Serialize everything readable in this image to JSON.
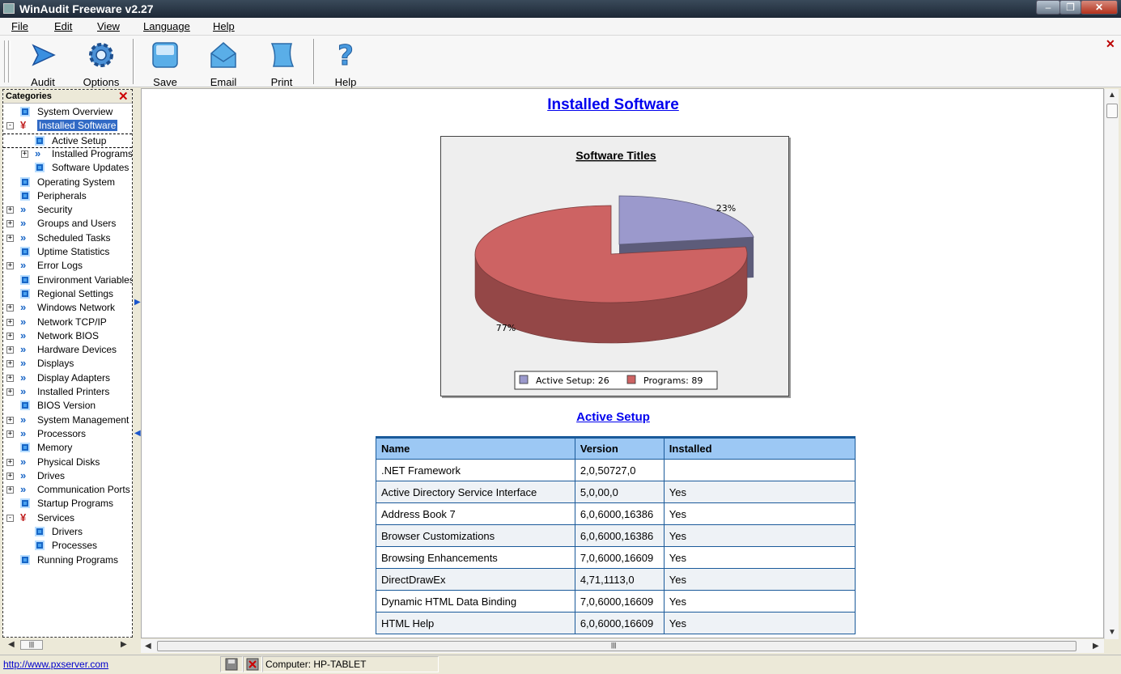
{
  "window": {
    "title": "WinAudit Freeware v2.27"
  },
  "menu": [
    "File",
    "Edit",
    "View",
    "Language",
    "Help"
  ],
  "toolbar": {
    "audit_label": "Audit",
    "options_label": "Options",
    "save_label": "Save",
    "email_label": "Email",
    "print_label": "Print",
    "help_label": "Help"
  },
  "sidebar": {
    "header": "Categories",
    "items": [
      {
        "label": "System Overview"
      },
      {
        "label": "Installed Software"
      },
      {
        "label": "Active Setup"
      },
      {
        "label": "Installed Programs"
      },
      {
        "label": "Software Updates"
      },
      {
        "label": "Operating System"
      },
      {
        "label": "Peripherals"
      },
      {
        "label": "Security"
      },
      {
        "label": "Groups and Users"
      },
      {
        "label": "Scheduled Tasks"
      },
      {
        "label": "Uptime Statistics"
      },
      {
        "label": "Error Logs"
      },
      {
        "label": "Environment Variables"
      },
      {
        "label": "Regional Settings"
      },
      {
        "label": "Windows Network"
      },
      {
        "label": "Network TCP/IP"
      },
      {
        "label": "Network BIOS"
      },
      {
        "label": "Hardware Devices"
      },
      {
        "label": "Displays"
      },
      {
        "label": "Display Adapters"
      },
      {
        "label": "Installed Printers"
      },
      {
        "label": "BIOS Version"
      },
      {
        "label": "System Management"
      },
      {
        "label": "Processors"
      },
      {
        "label": "Memory"
      },
      {
        "label": "Physical Disks"
      },
      {
        "label": "Drives"
      },
      {
        "label": "Communication Ports"
      },
      {
        "label": "Startup Programs"
      },
      {
        "label": "Services"
      },
      {
        "label": "Drivers"
      },
      {
        "label": "Processes"
      },
      {
        "label": "Running Programs"
      }
    ]
  },
  "main": {
    "title": "Installed Software",
    "section_title": "Active Setup",
    "table": {
      "headers": [
        "Name",
        "Version",
        "Installed"
      ],
      "rows": [
        [
          ".NET Framework",
          "2,0,50727,0",
          ""
        ],
        [
          "Active Directory Service Interface",
          "5,0,00,0",
          "Yes"
        ],
        [
          "Address Book 7",
          "6,0,6000,16386",
          "Yes"
        ],
        [
          "Browser Customizations",
          "6,0,6000,16386",
          "Yes"
        ],
        [
          "Browsing Enhancements",
          "7,0,6000,16609",
          "Yes"
        ],
        [
          "DirectDrawEx",
          "4,71,1113,0",
          "Yes"
        ],
        [
          "Dynamic HTML Data Binding",
          "7,0,6000,16609",
          "Yes"
        ],
        [
          "HTML Help",
          "6,0,6000,16609",
          "Yes"
        ]
      ]
    }
  },
  "chart_data": {
    "type": "pie",
    "title": "Software Titles",
    "slices": [
      {
        "name": "Active Setup",
        "value": 26,
        "percent_label": "23%",
        "color": "#9b99cc"
      },
      {
        "name": "Programs",
        "value": 89,
        "percent_label": "77%",
        "color": "#cd6363"
      }
    ],
    "legend": [
      "Active Setup: 26",
      "Programs: 89"
    ],
    "legend_position": "bottom"
  },
  "status": {
    "link": "http://www.pxserver.com",
    "computer": "Computer: HP-TABLET"
  },
  "colors": {
    "accent": "#316ac5",
    "link": "#0000ee",
    "table_header": "#9cc8f4"
  }
}
